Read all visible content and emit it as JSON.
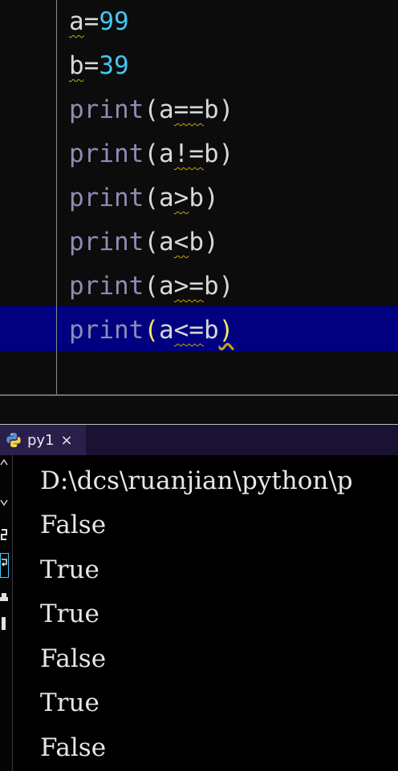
{
  "editor": {
    "lines": [
      {
        "var": "a",
        "op": "=",
        "num": "99"
      },
      {
        "var": "b",
        "op": "=",
        "num": "39"
      },
      {
        "kw": "print",
        "open": "(",
        "left": "a",
        "op": "==",
        "right": "b",
        "close": ")"
      },
      {
        "kw": "print",
        "open": "(",
        "left": "a",
        "op": "!=",
        "right": "b",
        "close": ")"
      },
      {
        "kw": "print",
        "open": "(",
        "left": "a",
        "op": ">",
        "right": "b",
        "close": ")"
      },
      {
        "kw": "print",
        "open": "(",
        "left": "a",
        "op": "<",
        "right": "b",
        "close": ")"
      },
      {
        "kw": "print",
        "open": "(",
        "left": "a",
        "op": ">=",
        "right": "b",
        "close": ")"
      },
      {
        "kw": "print",
        "open": "(",
        "left": "a",
        "op": "<=",
        "right": "b",
        "close": ")"
      }
    ]
  },
  "console_tab": {
    "label": "py1",
    "close_glyph": "×",
    "icon": "python-icon"
  },
  "console": {
    "lines": [
      "D:\\dcs\\ruanjian\\python\\p",
      "False",
      "True",
      "True",
      "False",
      "True",
      "False"
    ]
  },
  "colors": {
    "editor_bg": "#0c0c0c",
    "current_line_bg": "#000080",
    "keyword": "#8c8cb4",
    "number": "#3fc8f4",
    "paren_match": "#f5e663",
    "tabbar_bg": "#1b1233",
    "console_bg": "#000000"
  }
}
